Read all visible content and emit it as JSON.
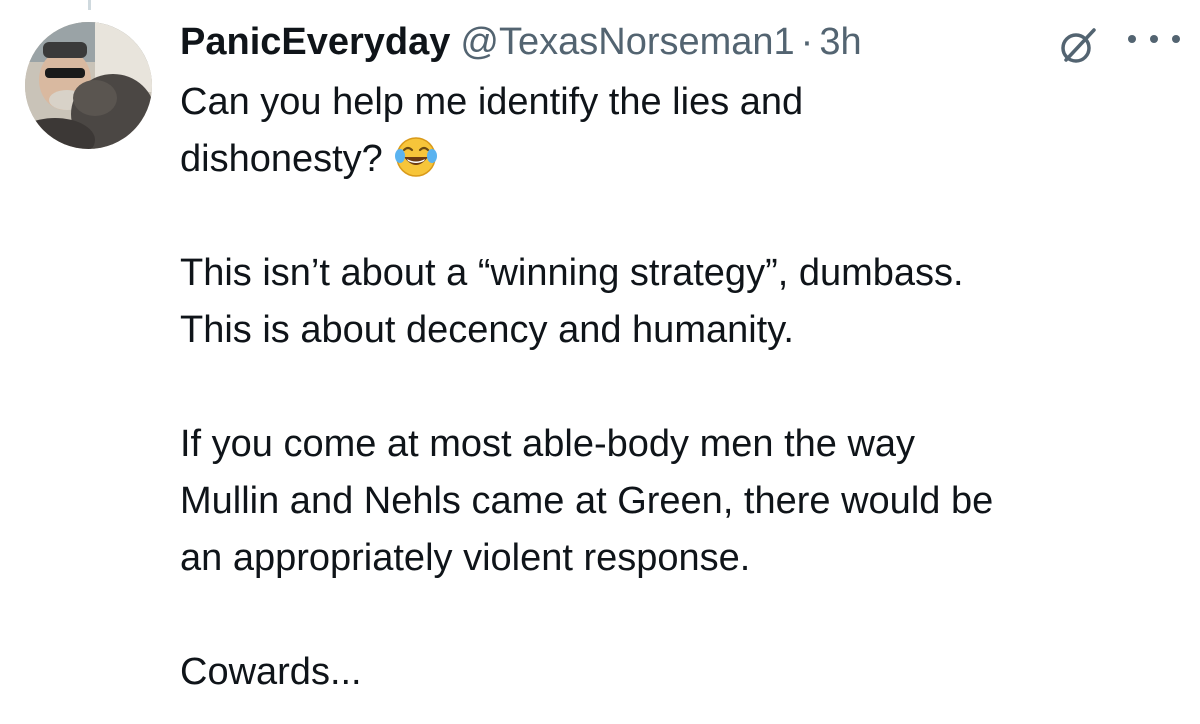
{
  "tweet": {
    "display_name": "PanicEveryday",
    "handle": "@TexasNorseman1",
    "separator": "·",
    "time": "3h",
    "body": {
      "p1_line1": "Can you help me identify the lies  and",
      "p1_line2": "dishonesty?",
      "p1_emoji": "face-with-tears-of-joy",
      "p2_line1": "This isn’t about a “winning strategy”, dumbass.",
      "p2_line2": "This is about decency and humanity.",
      "p3_line1": "If you come at most able-body men the way",
      "p3_line2": "Mullin and Nehls came at Green, there would be",
      "p3_line3": "an appropriately violent response.",
      "p4_line1": "Cowards..."
    }
  },
  "icons": {
    "grok": "grok-icon",
    "more": "more-options-icon",
    "avatar": "avatar"
  },
  "colors": {
    "text_primary": "#0f1419",
    "text_secondary": "#536471",
    "background": "#ffffff"
  }
}
